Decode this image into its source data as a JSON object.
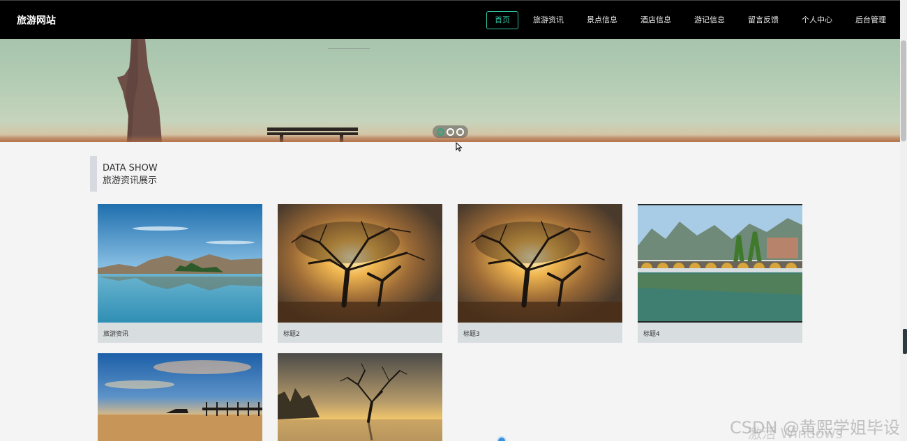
{
  "brand": {
    "title": "旅游网站"
  },
  "nav": {
    "items": [
      "首页",
      "旅游资讯",
      "景点信息",
      "酒店信息",
      "游记信息",
      "留言反馈",
      "个人中心",
      "后台管理"
    ],
    "active_index": 0
  },
  "banner": {
    "slide_count": 3,
    "active_slide": 0
  },
  "section": {
    "title_en": "DATA SHOW",
    "title_cn": "旅游资讯展示"
  },
  "cards": [
    {
      "caption": "旅游资讯",
      "image": "lake-mountains-photo"
    },
    {
      "caption": "标题2",
      "image": "sunset-tree-photo"
    },
    {
      "caption": "标题3",
      "image": "sunset-tree-photo"
    },
    {
      "caption": "标题4",
      "image": "stone-bridge-river-photo"
    },
    {
      "caption": "",
      "image": "pier-sunset-photo"
    },
    {
      "caption": "",
      "image": "lone-tree-lake-photo"
    }
  ],
  "watermark": {
    "csdn": "CSDN @黄熙学姐毕设",
    "windows": "激活 Windows"
  }
}
